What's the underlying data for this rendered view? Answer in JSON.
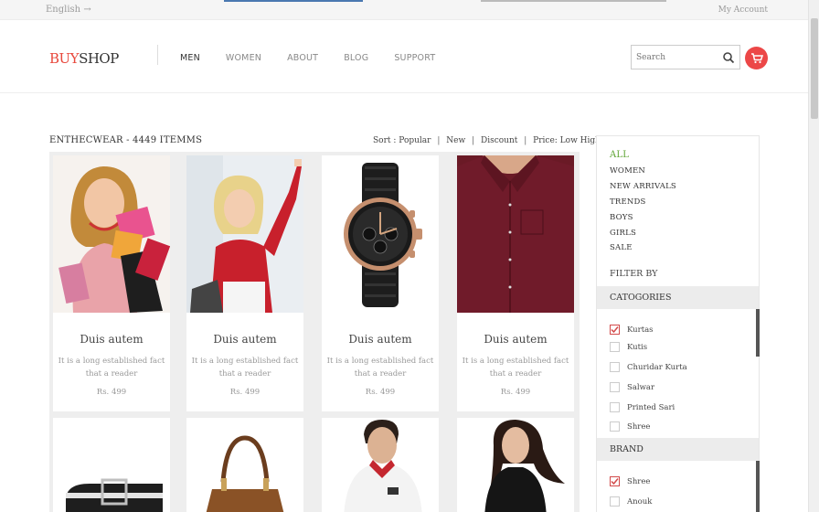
{
  "topbar": {
    "language": "English",
    "language_arrow": "→",
    "account": "My Account"
  },
  "header": {
    "logo": {
      "part1": "BUY",
      "part2": "SHOP"
    },
    "nav": [
      {
        "label": "MEN",
        "active": true
      },
      {
        "label": "WOMEN",
        "active": false
      },
      {
        "label": "ABOUT",
        "active": false
      },
      {
        "label": "BLOG",
        "active": false
      },
      {
        "label": "SUPPORT",
        "active": false
      }
    ],
    "search_placeholder": "Search",
    "icons": {
      "search": "search-icon",
      "cart": "cart-icon"
    }
  },
  "listing": {
    "title": "ENTHECWEAR - 4449 ITEMMS",
    "sort": {
      "label": "Sort : Popular",
      "options": [
        "New",
        "Discount",
        "Price: Low High"
      ],
      "separator": "|"
    }
  },
  "products": [
    {
      "title": "Duis autem",
      "desc": "It is a long established fact that a reader",
      "price": "Rs. 499",
      "image": "shopping-woman"
    },
    {
      "title": "Duis autem",
      "desc": "It is a long established fact that a reader",
      "price": "Rs. 499",
      "image": "woman-red-top"
    },
    {
      "title": "Duis autem",
      "desc": "It is a long established fact that a reader",
      "price": "Rs. 499",
      "image": "wristwatch"
    },
    {
      "title": "Duis autem",
      "desc": "It is a long established fact that a reader",
      "price": "Rs. 499",
      "image": "maroon-shirt"
    },
    {
      "title": "",
      "desc": "",
      "price": "",
      "image": "belt"
    },
    {
      "title": "",
      "desc": "",
      "price": "",
      "image": "handbag"
    },
    {
      "title": "",
      "desc": "",
      "price": "",
      "image": "man-polo"
    },
    {
      "title": "",
      "desc": "",
      "price": "",
      "image": "woman-black-top"
    }
  ],
  "sidebar": {
    "categories": [
      "ALL",
      "WOMEN",
      "NEW ARRIVALS",
      "TRENDS",
      "BOYS",
      "GIRLS",
      "SALE"
    ],
    "filter_by": "FILTER BY",
    "category_group": {
      "title": "CATOGORIES",
      "options": [
        {
          "label": "Kurtas",
          "checked": true
        },
        {
          "label": "Kutis",
          "checked": false
        },
        {
          "label": "Churidar Kurta",
          "checked": false
        },
        {
          "label": "Salwar",
          "checked": false
        },
        {
          "label": "Printed Sari",
          "checked": false
        },
        {
          "label": "Shree",
          "checked": false
        }
      ]
    },
    "brand_group": {
      "title": "BRAND",
      "options": [
        {
          "label": "Shree",
          "checked": true
        },
        {
          "label": "Anouk",
          "checked": false
        }
      ]
    }
  },
  "colors": {
    "accent": "#e8473b",
    "all_link": "#5ca331",
    "cart_bg": "#ec4747"
  }
}
